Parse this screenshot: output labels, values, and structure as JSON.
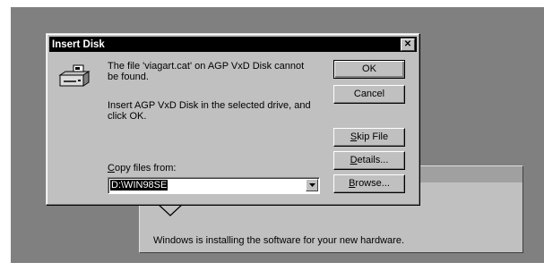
{
  "background_window": {
    "status_text": "Windows is installing the software for your new hardware."
  },
  "dialog": {
    "title": "Insert Disk",
    "close_glyph": "✕",
    "message_line1": "The file 'viagart.cat' on AGP VxD Disk cannot be found.",
    "message_line2": "Insert AGP VxD Disk in the selected drive, and click OK.",
    "copy_label_mnemonic": "C",
    "copy_label_rest": "opy files from:",
    "copy_from_value": "D:\\WIN98SE",
    "icon": "disk-drive-icon"
  },
  "buttons": {
    "ok": "OK",
    "cancel": "Cancel",
    "skip_mnemonic": "S",
    "skip_rest": "kip File",
    "details_mnemonic": "D",
    "details_rest": "etails...",
    "browse_mnemonic": "B",
    "browse_rest": "rowse..."
  },
  "colors": {
    "face": "#c0c0c0",
    "desktop": "#808080",
    "titlebar": "#000000"
  }
}
